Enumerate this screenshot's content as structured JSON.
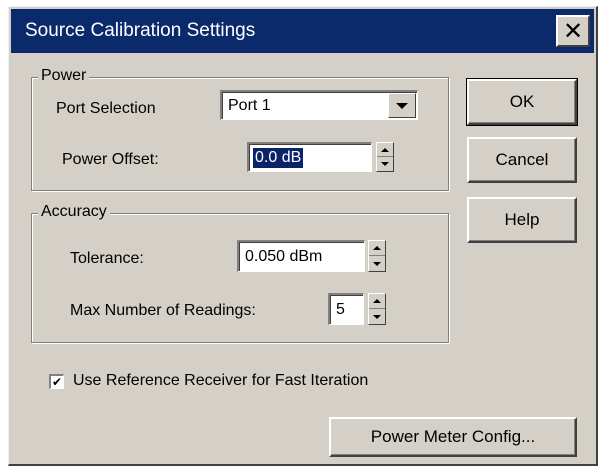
{
  "window": {
    "title": "Source Calibration Settings",
    "close_glyph": "✕"
  },
  "power": {
    "group_label": "Power",
    "port_label": "Port Selection",
    "port_value": "Port 1",
    "offset_label": "Power Offset:",
    "offset_value": "0.0 dB"
  },
  "accuracy": {
    "group_label": "Accuracy",
    "tolerance_label": "Tolerance:",
    "tolerance_value": "0.050 dBm",
    "max_readings_label": "Max Number of Readings:",
    "max_readings_value": "5"
  },
  "options": {
    "ref_receiver_label": "Use Reference Receiver for Fast Iteration",
    "ref_receiver_checked": true,
    "check_glyph": "✔"
  },
  "buttons": {
    "ok": "OK",
    "cancel": "Cancel",
    "help": "Help",
    "power_meter_config": "Power Meter Config..."
  },
  "colors": {
    "titlebar": "#0b2a6b",
    "dialog_bg": "#d4d0c8",
    "selection": "#0a246a"
  }
}
